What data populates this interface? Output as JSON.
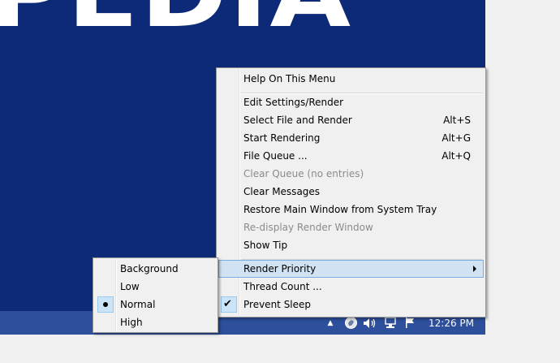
{
  "desktop": {
    "brand_text": "PEDIA"
  },
  "tray": {
    "up_arrow_icon": "chevron-up-icon",
    "clock": "12:26 PM"
  },
  "main_menu": {
    "items": [
      {
        "label": "Help On This Menu",
        "shortcut": "",
        "disabled": false
      },
      {
        "label": "Edit Settings/Render",
        "shortcut": "",
        "disabled": false
      },
      {
        "label": "Select File and Render",
        "shortcut": "Alt+S",
        "disabled": false
      },
      {
        "label": "Start Rendering",
        "shortcut": "Alt+G",
        "disabled": false
      },
      {
        "label": "File Queue ...",
        "shortcut": "Alt+Q",
        "disabled": false
      },
      {
        "label": "Clear Queue (no entries)",
        "shortcut": "",
        "disabled": true
      },
      {
        "label": "Clear Messages",
        "shortcut": "",
        "disabled": false
      },
      {
        "label": "Restore Main Window from System Tray",
        "shortcut": "",
        "disabled": false
      },
      {
        "label": "Re-display Render Window",
        "shortcut": "",
        "disabled": true
      },
      {
        "label": "Show Tip",
        "shortcut": "",
        "disabled": false
      },
      {
        "label": "Render Priority",
        "shortcut": "",
        "disabled": false,
        "highlighted": true,
        "has_submenu": true
      },
      {
        "label": "Thread Count ...",
        "shortcut": "",
        "disabled": false
      },
      {
        "label": "Prevent Sleep",
        "shortcut": "",
        "disabled": false,
        "checked": true
      }
    ]
  },
  "priority_menu": {
    "items": [
      {
        "label": "Background",
        "selected": false
      },
      {
        "label": "Low",
        "selected": false
      },
      {
        "label": "Normal",
        "selected": true
      },
      {
        "label": "High",
        "selected": false
      }
    ]
  },
  "colors": {
    "desktop_bg": "#0d2a78",
    "taskbar_bg": "#2d4f9c",
    "menu_bg": "#f0f0f0",
    "highlight_bg": "#d1e2f2",
    "highlight_border": "#78aee5"
  }
}
